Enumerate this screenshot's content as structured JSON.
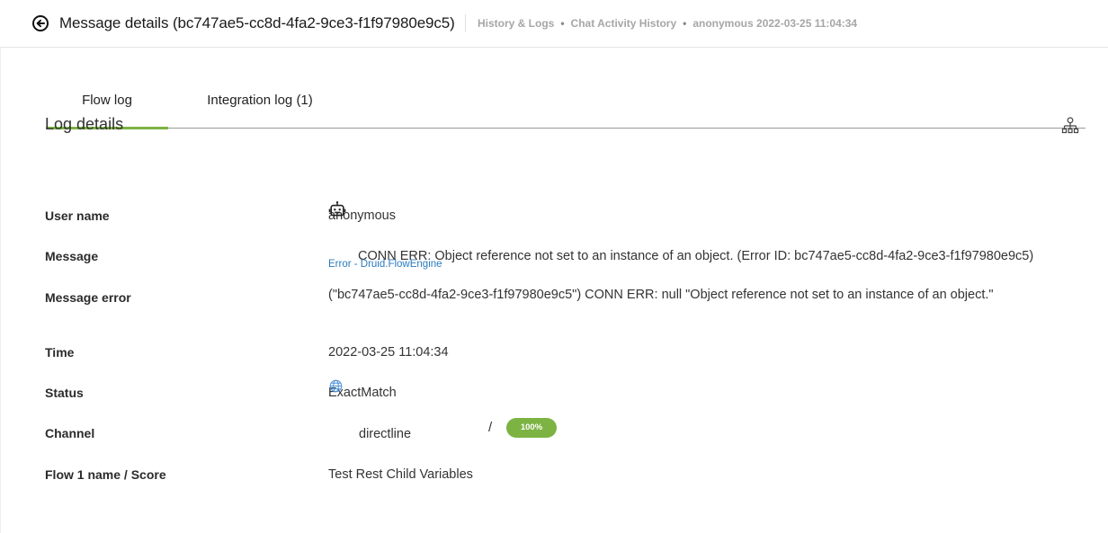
{
  "header": {
    "title": "Message details (bc747ae5-cc8d-4fa2-9ce3-f1f97980e9c5)",
    "breadcrumb": [
      "History & Logs",
      "Chat Activity History",
      "anonymous 2022-03-25 11:04:34"
    ],
    "separator": "•"
  },
  "tabs": [
    {
      "label": "Flow log",
      "active": true
    },
    {
      "label": "Integration log (1)",
      "active": false
    }
  ],
  "section": {
    "title": "Log details"
  },
  "details": {
    "user_name": {
      "label": "User name",
      "value": "anonymous"
    },
    "message": {
      "label": "Message",
      "value": "CONN ERR: Object reference not set to an instance of an object. (Error ID: bc747ae5-cc8d-4fa2-9ce3-f1f97980e9c5)",
      "icon": "robot-icon"
    },
    "message_error": {
      "label": "Message error",
      "value": "(\"bc747ae5-cc8d-4fa2-9ce3-f1f97980e9c5\") CONN ERR: null \"Object reference not set to an instance of an object.\"",
      "source": "Error - Druid.FlowEngine"
    },
    "time": {
      "label": "Time",
      "value": "2022-03-25 11:04:34"
    },
    "status": {
      "label": "Status",
      "value": "ExactMatch"
    },
    "channel": {
      "label": "Channel",
      "value": "directline",
      "icon": "globe-icon"
    },
    "flow": {
      "label": "Flow 1 name / Score",
      "name": "Test Rest Child Variables",
      "separator": "/",
      "score": "100%"
    }
  },
  "colors": {
    "accent": "#7cb342",
    "link": "#2a7bbf",
    "breadcrumb": "#a6a6a6"
  }
}
